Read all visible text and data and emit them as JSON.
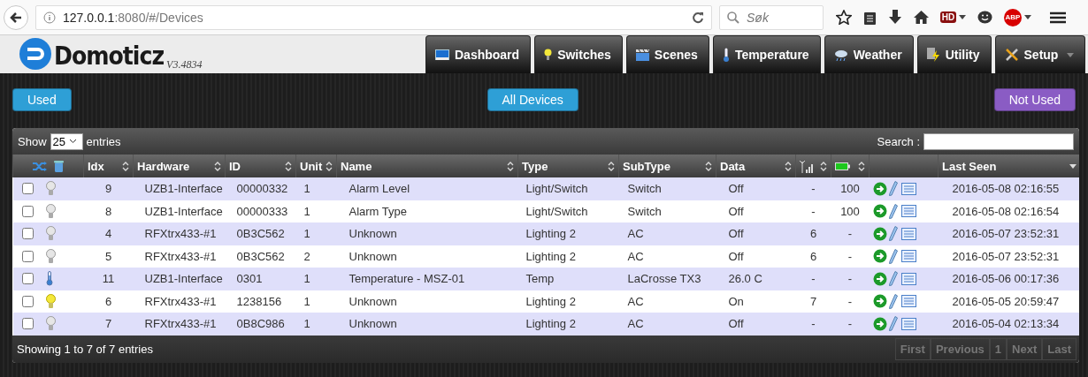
{
  "browser": {
    "url_host": "127.0.0.1",
    "url_path": ":8080/#/Devices",
    "search_placeholder": "Søk",
    "badges": [
      {
        "kind": "hd",
        "text": "HD"
      },
      {
        "kind": "abp",
        "text": "ABP"
      }
    ]
  },
  "logo": {
    "name": "Domoticz",
    "version": "V3.4834"
  },
  "nav": [
    {
      "kind": "dashboard",
      "label": "Dashboard",
      "dropdown": false
    },
    {
      "kind": "switches",
      "label": "Switches",
      "dropdown": false
    },
    {
      "kind": "scenes",
      "label": "Scenes",
      "dropdown": false
    },
    {
      "kind": "temperature",
      "label": "Temperature",
      "dropdown": false
    },
    {
      "kind": "weather",
      "label": "Weather",
      "dropdown": false
    },
    {
      "kind": "utility",
      "label": "Utility",
      "dropdown": false
    },
    {
      "kind": "setup",
      "label": "Setup",
      "dropdown": true
    }
  ],
  "filters": [
    {
      "label": "Used",
      "color": "#2e9fd6"
    },
    {
      "label": "All Devices",
      "color": "#2e9fd6"
    },
    {
      "label": "Not Used",
      "color": "#8a5cc4"
    }
  ],
  "table": {
    "show_label": "Show",
    "page_size": "25",
    "entries_label": "entries",
    "search_label": "Search :",
    "columns": [
      {
        "kind": "tools"
      },
      {
        "kind": "text",
        "label": "Idx",
        "sorted_descending": false
      },
      {
        "kind": "text",
        "label": "Hardware",
        "sorted_descending": false
      },
      {
        "kind": "text",
        "label": "ID",
        "sorted_descending": false
      },
      {
        "kind": "text",
        "label": "Unit",
        "sorted_descending": false
      },
      {
        "kind": "text",
        "label": "Name",
        "sorted_descending": false
      },
      {
        "kind": "text",
        "label": "Type",
        "sorted_descending": false
      },
      {
        "kind": "text",
        "label": "SubType",
        "sorted_descending": false
      },
      {
        "kind": "text",
        "label": "Data",
        "sorted_descending": false
      },
      {
        "kind": "signal",
        "sorted_descending": false
      },
      {
        "kind": "battery",
        "sorted_descending": false
      },
      {
        "kind": "blank"
      },
      {
        "kind": "text",
        "label": "Last Seen",
        "sorted_descending": true
      }
    ],
    "rows": [
      {
        "checked": false,
        "kind": "switch",
        "on": false,
        "idx": "9",
        "hardware": "UZB1-Interface",
        "id": "00000332",
        "unit": "1",
        "name": "Alarm Level",
        "type": "Light/Switch",
        "subtype": "Switch",
        "data": "Off",
        "signal": "-",
        "battery": "100",
        "last_seen": "2016-05-08 02:16:55"
      },
      {
        "checked": false,
        "kind": "switch",
        "on": false,
        "idx": "8",
        "hardware": "UZB1-Interface",
        "id": "00000333",
        "unit": "1",
        "name": "Alarm Type",
        "type": "Light/Switch",
        "subtype": "Switch",
        "data": "Off",
        "signal": "-",
        "battery": "100",
        "last_seen": "2016-05-08 02:16:54"
      },
      {
        "checked": false,
        "kind": "switch",
        "on": false,
        "idx": "4",
        "hardware": "RFXtrx433-#1",
        "id": "0B3C562",
        "unit": "1",
        "name": "Unknown",
        "type": "Lighting 2",
        "subtype": "AC",
        "data": "Off",
        "signal": "6",
        "battery": "-",
        "last_seen": "2016-05-07 23:52:31"
      },
      {
        "checked": false,
        "kind": "switch",
        "on": false,
        "idx": "5",
        "hardware": "RFXtrx433-#1",
        "id": "0B3C562",
        "unit": "2",
        "name": "Unknown",
        "type": "Lighting 2",
        "subtype": "AC",
        "data": "Off",
        "signal": "6",
        "battery": "-",
        "last_seen": "2016-05-07 23:52:31"
      },
      {
        "checked": false,
        "kind": "temperature",
        "idx": "11",
        "hardware": "UZB1-Interface",
        "id": "0301",
        "unit": "1",
        "name": "Temperature - MSZ-01",
        "type": "Temp",
        "subtype": "LaCrosse TX3",
        "data": "26.0 C",
        "signal": "-",
        "battery": "-",
        "last_seen": "2016-05-06 00:17:36"
      },
      {
        "checked": false,
        "kind": "switch",
        "on": true,
        "idx": "6",
        "hardware": "RFXtrx433-#1",
        "id": "1238156",
        "unit": "1",
        "name": "Unknown",
        "type": "Lighting 2",
        "subtype": "AC",
        "data": "On",
        "signal": "7",
        "battery": "-",
        "last_seen": "2016-05-05 20:59:47"
      },
      {
        "checked": false,
        "kind": "switch",
        "on": false,
        "idx": "7",
        "hardware": "RFXtrx433-#1",
        "id": "0B8C986",
        "unit": "1",
        "name": "Unknown",
        "type": "Lighting 2",
        "subtype": "AC",
        "data": "Off",
        "signal": "-",
        "battery": "-",
        "last_seen": "2016-05-04 02:13:34"
      }
    ],
    "info": "Showing 1 to 7 of 7 entries",
    "pagination": [
      {
        "label": "First",
        "disabled": true
      },
      {
        "label": "Previous",
        "disabled": true
      },
      {
        "label": "1",
        "disabled": true
      },
      {
        "label": "Next",
        "disabled": true
      },
      {
        "label": "Last",
        "disabled": true
      }
    ]
  }
}
